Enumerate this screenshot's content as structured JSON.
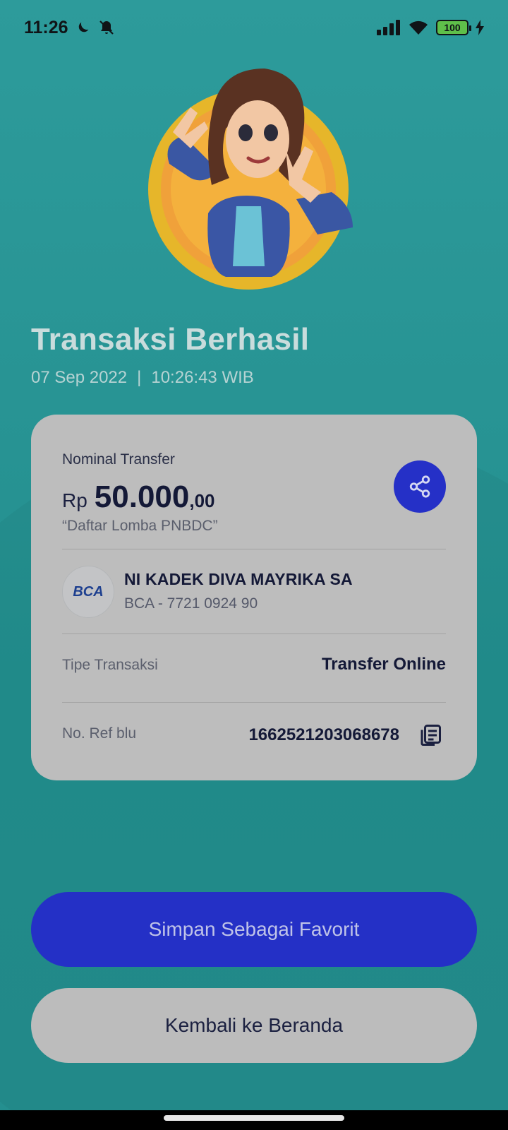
{
  "statusbar": {
    "time": "11:26",
    "battery": "100"
  },
  "header": {
    "title": "Transaksi Berhasil",
    "date": "07 Sep 2022",
    "separator": "|",
    "time": "10:26:43 WIB"
  },
  "card": {
    "nominal_label": "Nominal Transfer",
    "currency": "Rp",
    "amount_main": "50.000",
    "amount_cents": ",00",
    "note": "“Daftar Lomba PNBDC”",
    "bank_logo_text": "BCA",
    "recipient_name": "NI KADEK DIVA MAYRIKA SA",
    "recipient_account": "BCA - 7721 0924 90",
    "type_label": "Tipe Transaksi",
    "type_value": "Transfer Online",
    "ref_label": "No. Ref blu",
    "ref_value": "1662521203068678"
  },
  "buttons": {
    "favorite": "Simpan Sebagai Favorit",
    "home": "Kembali ke Beranda"
  },
  "colors": {
    "background": "#2a9797",
    "primary": "#2430c6",
    "card": "#bdbdbd"
  }
}
